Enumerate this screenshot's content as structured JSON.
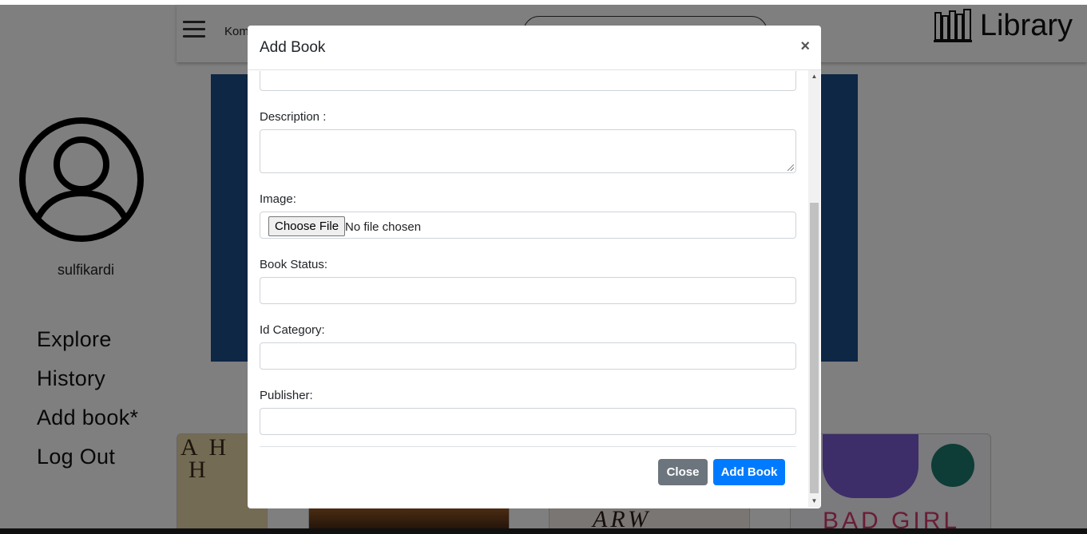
{
  "app": {
    "brand": "Library",
    "sort_label": "Kom",
    "username": "sulfikardi"
  },
  "nav": {
    "items": [
      {
        "label": "Explore"
      },
      {
        "label": "History"
      },
      {
        "label": "Add book*"
      },
      {
        "label": "Log Out"
      }
    ]
  },
  "cards": {
    "card1_text_line1": "A H",
    "card1_text_line2": "H",
    "card3_text": "ARW",
    "card4_text": "BAD GIRL"
  },
  "modal": {
    "title": "Add Book",
    "close_x": "×",
    "fields": {
      "description_label": "Description :",
      "image_label": "Image:",
      "file_button": "Choose File",
      "file_status": "No file chosen",
      "book_status_label": "Book Status:",
      "id_category_label": "Id Category:",
      "publisher_label": "Publisher:"
    },
    "buttons": {
      "close": "Close",
      "add": "Add Book"
    }
  },
  "colors": {
    "primary": "#007bff",
    "secondary": "#6c757d",
    "banner": "#1a4f8b"
  }
}
